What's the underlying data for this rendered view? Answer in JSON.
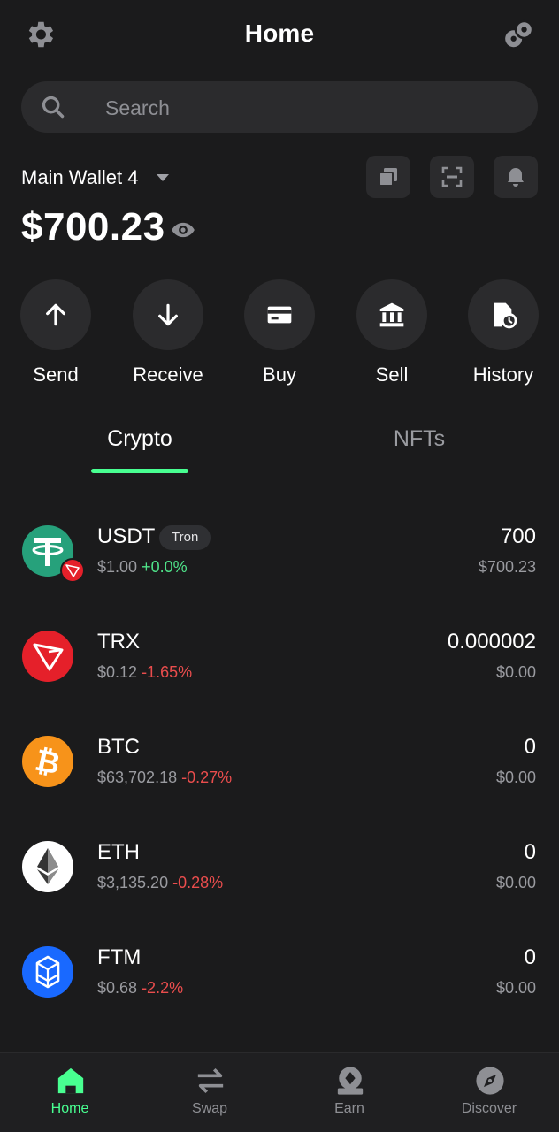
{
  "header": {
    "title": "Home"
  },
  "search": {
    "placeholder": "Search"
  },
  "wallet": {
    "name": "Main Wallet 4",
    "balance": "$700.23"
  },
  "actions": [
    {
      "label": "Send"
    },
    {
      "label": "Receive"
    },
    {
      "label": "Buy"
    },
    {
      "label": "Sell"
    },
    {
      "label": "History"
    }
  ],
  "tabs": [
    {
      "label": "Crypto",
      "active": true
    },
    {
      "label": "NFTs",
      "active": false
    }
  ],
  "assets": [
    {
      "symbol": "USDT",
      "network": "Tron",
      "price": "$1.00",
      "change": "+0.0%",
      "amount": "700",
      "value": "$700.23"
    },
    {
      "symbol": "TRX",
      "price": "$0.12",
      "change": "-1.65%",
      "amount": "0.000002",
      "value": "$0.00"
    },
    {
      "symbol": "BTC",
      "price": "$63,702.18",
      "change": "-0.27%",
      "amount": "0",
      "value": "$0.00"
    },
    {
      "symbol": "ETH",
      "price": "$3,135.20",
      "change": "-0.28%",
      "amount": "0",
      "value": "$0.00"
    },
    {
      "symbol": "FTM",
      "price": "$0.68",
      "change": "-2.2%",
      "amount": "0",
      "value": "$0.00"
    }
  ],
  "nav": [
    {
      "label": "Home",
      "icon": "home-icon",
      "active": true
    },
    {
      "label": "Swap",
      "icon": "swap-icon",
      "active": false
    },
    {
      "label": "Earn",
      "icon": "earn-icon",
      "active": false
    },
    {
      "label": "Discover",
      "icon": "compass-icon",
      "active": false
    }
  ],
  "colors": {
    "background": "#1b1b1c",
    "surface": "#2b2b2d",
    "accent": "#48ff91",
    "positive": "#4fe389",
    "negative": "#ea4d4d",
    "muted": "#9a9ba0"
  }
}
